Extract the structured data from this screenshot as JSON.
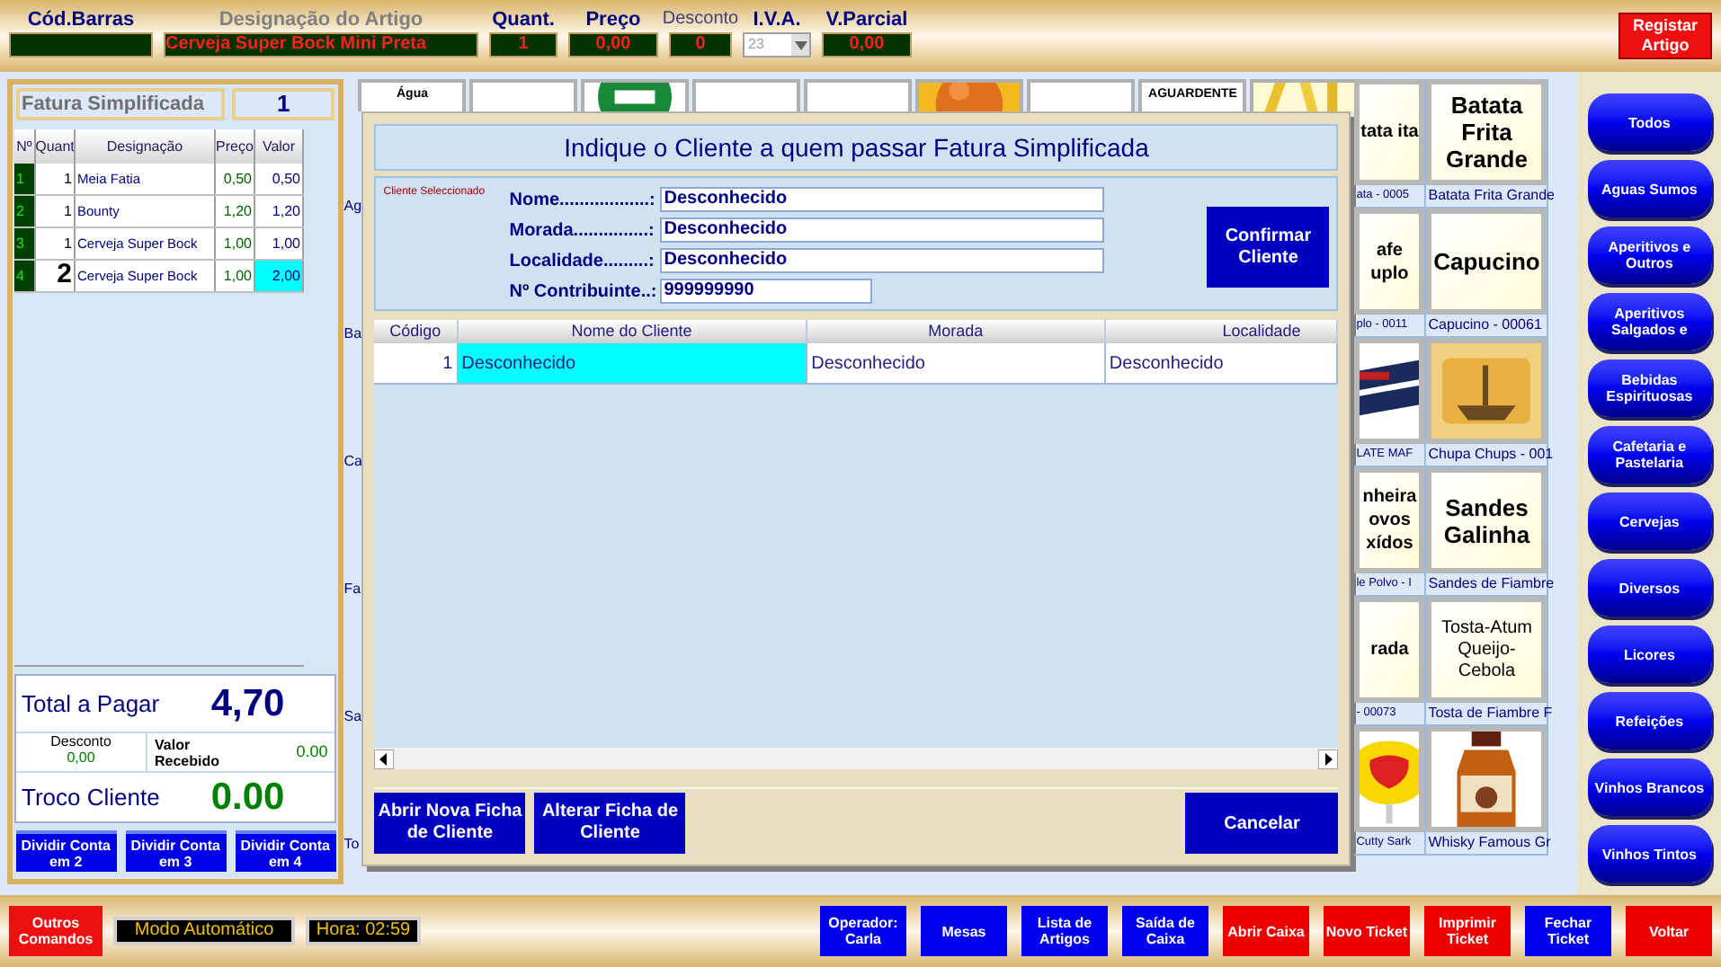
{
  "top_bar": {
    "fields": [
      {
        "kind": "text",
        "label": "Cód.Barras"
      },
      {
        "kind": "text",
        "label": "Designação do Artigo",
        "value": "Cerveja Super Bock Mini Preta"
      },
      {
        "kind": "text",
        "label": "Quant.",
        "value": "1"
      },
      {
        "kind": "text",
        "label": "Preço",
        "value": "0,00"
      },
      {
        "kind": "text",
        "label": "Desconto",
        "value": "0"
      },
      {
        "kind": "dropdown",
        "label": "I.V.A.",
        "value": "23",
        "disabled": true
      },
      {
        "kind": "text",
        "label": "V.Parcial",
        "value": "0,00"
      }
    ],
    "register_button": "Registar Artigo"
  },
  "ticket": {
    "title": "Fatura Simplificada",
    "number": "1",
    "columns": [
      "Nº",
      "Quant",
      "Designação",
      "Preço",
      "Valor"
    ],
    "rows": [
      {
        "n": "1",
        "quant": "1",
        "name": "Meia Fatia",
        "price": "0,50",
        "value": "0,50",
        "selected": false
      },
      {
        "n": "2",
        "quant": "1",
        "name": "Bounty",
        "price": "1,20",
        "value": "1,20",
        "selected": false
      },
      {
        "n": "3",
        "quant": "1",
        "name": "Cerveja Super Bock",
        "price": "1,00",
        "value": "1,00",
        "selected": false
      },
      {
        "n": "4",
        "quant": "2",
        "name": "Cerveja Super Bock",
        "price": "1,00",
        "value": "2,00",
        "selected": true
      }
    ],
    "total_label": "Total a Pagar",
    "total": "4,70",
    "discount_label": "Desconto",
    "discount": "0,00",
    "received_label": "Valor Recebido",
    "received": "0.00",
    "change_label": "Troco Cliente",
    "change": "0.00"
  },
  "split_buttons": [
    "Dividir Conta em 2",
    "Dividir Conta em 3",
    "Dividir Conta em 4"
  ],
  "products": {
    "top_strip": [
      {
        "kind": "text",
        "text": "Água"
      },
      {
        "kind": "blank"
      },
      {
        "kind": "picture"
      },
      {
        "kind": "blank"
      },
      {
        "kind": "blank"
      },
      {
        "kind": "picture"
      },
      {
        "kind": "blank"
      },
      {
        "kind": "text",
        "text": "AGUARDENTE"
      },
      {
        "kind": "picture"
      }
    ],
    "left_captions": [
      "Ag",
      "Ba",
      "Ca",
      "Fa",
      "Sa",
      "To"
    ],
    "partial_column": [
      {
        "kind": "text",
        "text": "tata ita",
        "caption": "ata - 0005"
      },
      {
        "kind": "text",
        "text": "afe uplo",
        "caption": "plo - 0011"
      },
      {
        "kind": "picture",
        "caption": "LATE MAF"
      },
      {
        "kind": "text",
        "text": "nheira ovos xídos",
        "caption": "le Polvo - I"
      },
      {
        "kind": "text",
        "text": "rada",
        "caption": "- 00073"
      },
      {
        "kind": "picture",
        "caption": "Cutty Sark"
      }
    ],
    "column": [
      {
        "kind": "text",
        "text": "Batata Frita Grande",
        "caption": "Batata Frita Grande"
      },
      {
        "kind": "text",
        "text": "Capucino",
        "caption": "Capucino - 00061"
      },
      {
        "kind": "picture",
        "caption": "Chupa Chups - 001"
      },
      {
        "kind": "text",
        "text": "Sandes Galinha",
        "caption": "Sandes de Fiambre"
      },
      {
        "kind": "text",
        "text": "Tosta-Atum Queijo-Cebola",
        "caption": "Tosta de Fiambre F"
      },
      {
        "kind": "picture",
        "caption": "Whisky Famous Gr"
      }
    ]
  },
  "dialog": {
    "title": "Indique o Cliente a quem passar Fatura Simplificada",
    "section_label": "Cliente Seleccionado",
    "fields": [
      {
        "label": "Nome..................:",
        "value": "Desconhecido",
        "wide": true
      },
      {
        "label": "Morada...............:",
        "value": "Desconhecido",
        "wide": true
      },
      {
        "label": "Localidade.........:",
        "value": "Desconhecido",
        "wide": true
      },
      {
        "label": "Nº Contribuinte..:",
        "value": "999999990",
        "wide": false
      }
    ],
    "confirm_button": "Confirmar Cliente",
    "columns": [
      "Código",
      "Nome do Cliente",
      "Morada",
      "Localidade"
    ],
    "rows": [
      {
        "cells": [
          "1",
          "Desconhecido",
          "Desconhecido",
          "Desconhecido"
        ],
        "selected": true
      }
    ],
    "buttons": [
      "Abrir Nova Ficha de Cliente",
      "Alterar Ficha de Cliente"
    ],
    "cancel_button": "Cancelar"
  },
  "categories": [
    "Todos",
    "Aguas Sumos",
    "Aperitivos e Outros",
    "Aperitivos Salgados e",
    "Bebidas Espirituosas",
    "Cafetaria e Pastelaria",
    "Cervejas",
    "Diversos",
    "Licores",
    "Refeições",
    "Vinhos Brancos",
    "Vinhos Tintos"
  ],
  "bottom_bar": {
    "left_button": "Outros Comandos",
    "mode": "Modo Automático",
    "time": "Hora: 02:59",
    "buttons": [
      {
        "label": "Operador: Carla",
        "color": "#0000ee"
      },
      {
        "label": "Mesas",
        "color": "#0000ee"
      },
      {
        "label": "Lista de Artigos",
        "color": "#0000ee"
      },
      {
        "label": "Saída de Caixa",
        "color": "#0000ee"
      },
      {
        "label": "Abrir Caixa",
        "color": "#ee0000"
      },
      {
        "label": "Novo Ticket",
        "color": "#ee0000"
      },
      {
        "label": "Imprimir Ticket",
        "color": "#ee0000"
      },
      {
        "label": "Fechar Ticket",
        "color": "#0000ee"
      },
      {
        "label": "Voltar",
        "color": "#ee0000"
      }
    ]
  }
}
